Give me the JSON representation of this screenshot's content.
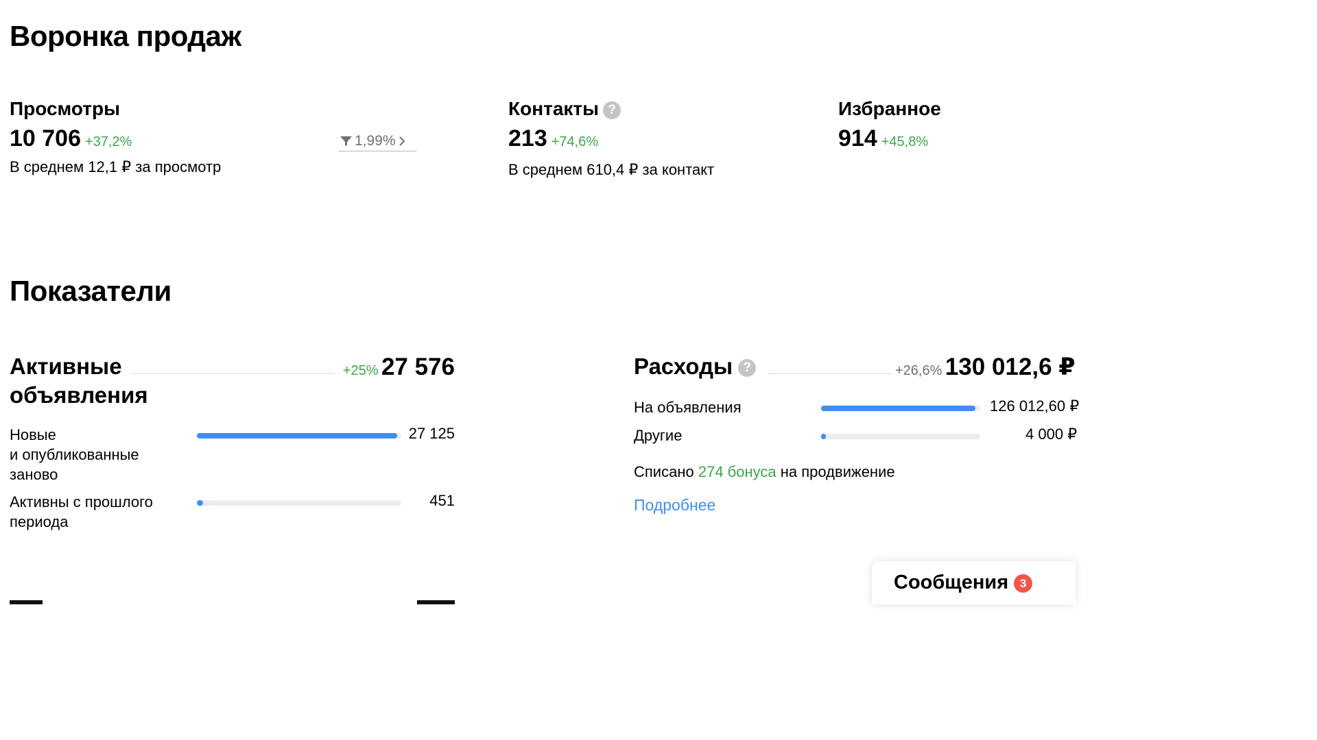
{
  "funnel": {
    "title": "Воронка продаж",
    "views": {
      "title": "Просмотры",
      "value": "10 706",
      "delta": "+37,2%",
      "subtitle": "В среднем 12,1 ₽ за просмотр",
      "conversion": "1,99%"
    },
    "contacts": {
      "title": "Контакты",
      "value": "213",
      "delta": "+74,6%",
      "subtitle": "В среднем 610,4 ₽ за контакт"
    },
    "favorites": {
      "title": "Избранное",
      "value": "914",
      "delta": "+45,8%"
    }
  },
  "indicators": {
    "title": "Показатели",
    "active": {
      "title_line1": "Активные",
      "title_line2": "объявления",
      "delta": "+25%",
      "value": "27 576",
      "rows": [
        {
          "label_lines": [
            "Новые",
            "и опубликованные",
            "заново"
          ],
          "value": "27 125",
          "fill": 0.98
        },
        {
          "label_lines": [
            "Активны с прошлого",
            "периода"
          ],
          "value": "451",
          "fill": 0.02
        }
      ]
    },
    "expenses": {
      "title": "Расходы",
      "delta": "+26,6%",
      "value": "130 012,6 ₽",
      "rows": [
        {
          "label": "На объявления",
          "value": "126 012,60 ₽",
          "fill": 0.97
        },
        {
          "label": "Другие",
          "value": "4 000 ₽",
          "fill": 0.03
        }
      ],
      "bonus_prefix": "Списано",
      "bonus_amount": "274 бонуса",
      "bonus_suffix": "на продвижение",
      "more_link": "Подробнее"
    }
  },
  "messages": {
    "title": "Сообщения",
    "count": "3"
  },
  "colors": {
    "accent": "#3f8ef1",
    "positive": "#3aa84a",
    "badge": "#f2554c"
  }
}
